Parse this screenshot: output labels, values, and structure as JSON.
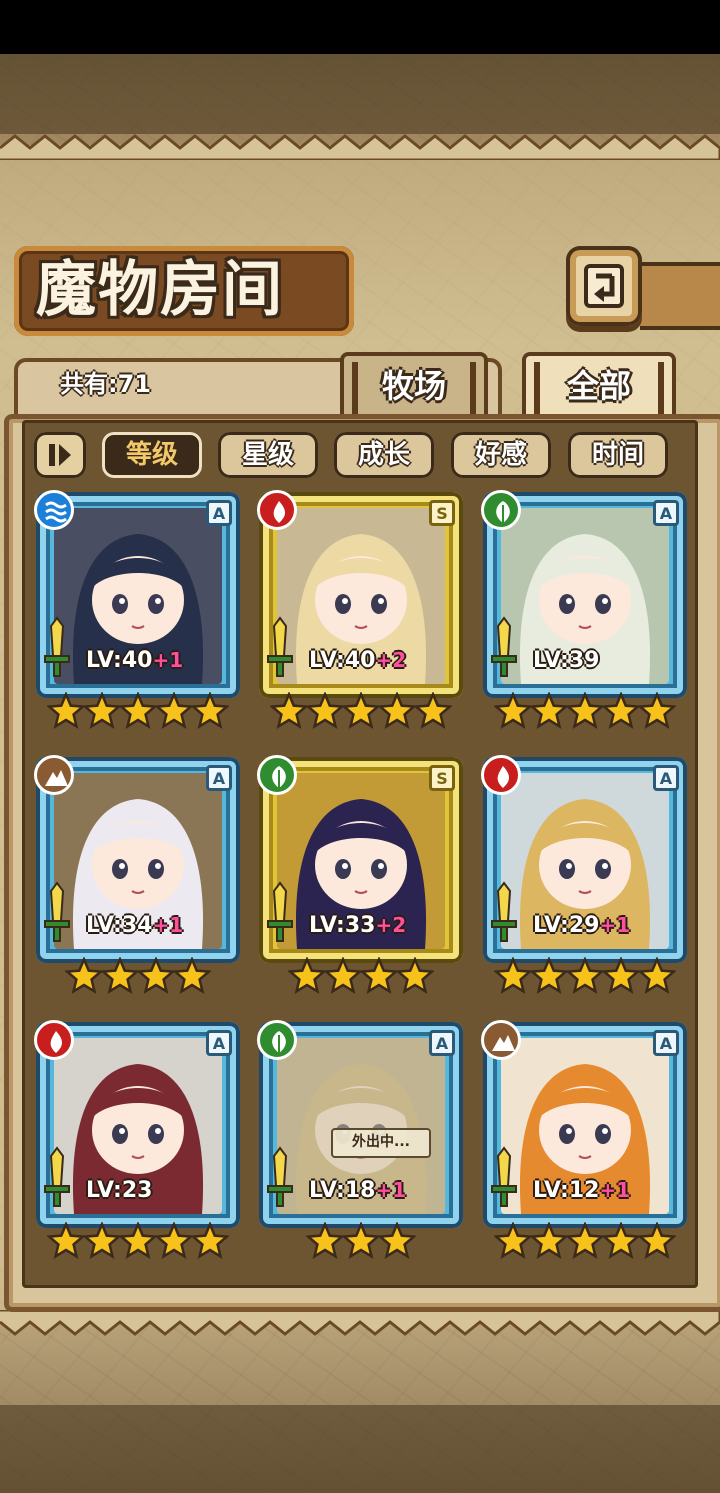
{
  "title": "魔物房间",
  "total_count": "共有:71",
  "tabs": {
    "ranch": "牧场",
    "all": "全部"
  },
  "sort_buttons": [
    "等级",
    "星级",
    "成长",
    "好感",
    "时间"
  ],
  "active_sort": "等级",
  "colors": {
    "frame_blue": "#55b8dc",
    "frame_gold": "#e0c53a",
    "plus_pink": "#ff4fa0",
    "wood_brown": "#7a5630"
  },
  "cards": [
    {
      "element": "water",
      "rank": "A",
      "frame": "blue",
      "level": "LV:40",
      "plus": "+1",
      "stars": 5,
      "hair": "#26304a",
      "bg": "#4a4e62",
      "away": ""
    },
    {
      "element": "fire",
      "rank": "S",
      "frame": "gold",
      "level": "LV:40",
      "plus": "+2",
      "stars": 5,
      "hair": "#ecd9a4",
      "bg": "#c8b894",
      "away": ""
    },
    {
      "element": "wood",
      "rank": "A",
      "frame": "blue",
      "level": "LV:39",
      "plus": "",
      "stars": 5,
      "hair": "#e8ecdf",
      "bg": "#b8c6b0",
      "away": ""
    },
    {
      "element": "earth",
      "rank": "A",
      "frame": "blue",
      "level": "LV:34",
      "plus": "+1",
      "stars": 4,
      "hair": "#eceaf0",
      "bg": "#8a7654",
      "away": ""
    },
    {
      "element": "wood",
      "rank": "S",
      "frame": "gold",
      "level": "LV:33",
      "plus": "+2",
      "stars": 4,
      "hair": "#2c2450",
      "bg": "#c29a36",
      "away": ""
    },
    {
      "element": "fire",
      "rank": "A",
      "frame": "blue",
      "level": "LV:29",
      "plus": "+1",
      "stars": 5,
      "hair": "#dcb660",
      "bg": "#cfd9dc",
      "away": ""
    },
    {
      "element": "fire",
      "rank": "A",
      "frame": "blue",
      "level": "LV:23",
      "plus": "",
      "stars": 5,
      "hair": "#7a2a30",
      "bg": "#d6d2cc",
      "away": ""
    },
    {
      "element": "wood",
      "rank": "A",
      "frame": "blue",
      "level": "LV:18",
      "plus": "+1",
      "stars": 3,
      "hair": "#c8b070",
      "bg": "#b8a880",
      "away": "外出中..."
    },
    {
      "element": "earth",
      "rank": "A",
      "frame": "blue",
      "level": "LV:12",
      "plus": "+1",
      "stars": 5,
      "hair": "#e58a2e",
      "bg": "#f0e4d0",
      "away": ""
    }
  ]
}
